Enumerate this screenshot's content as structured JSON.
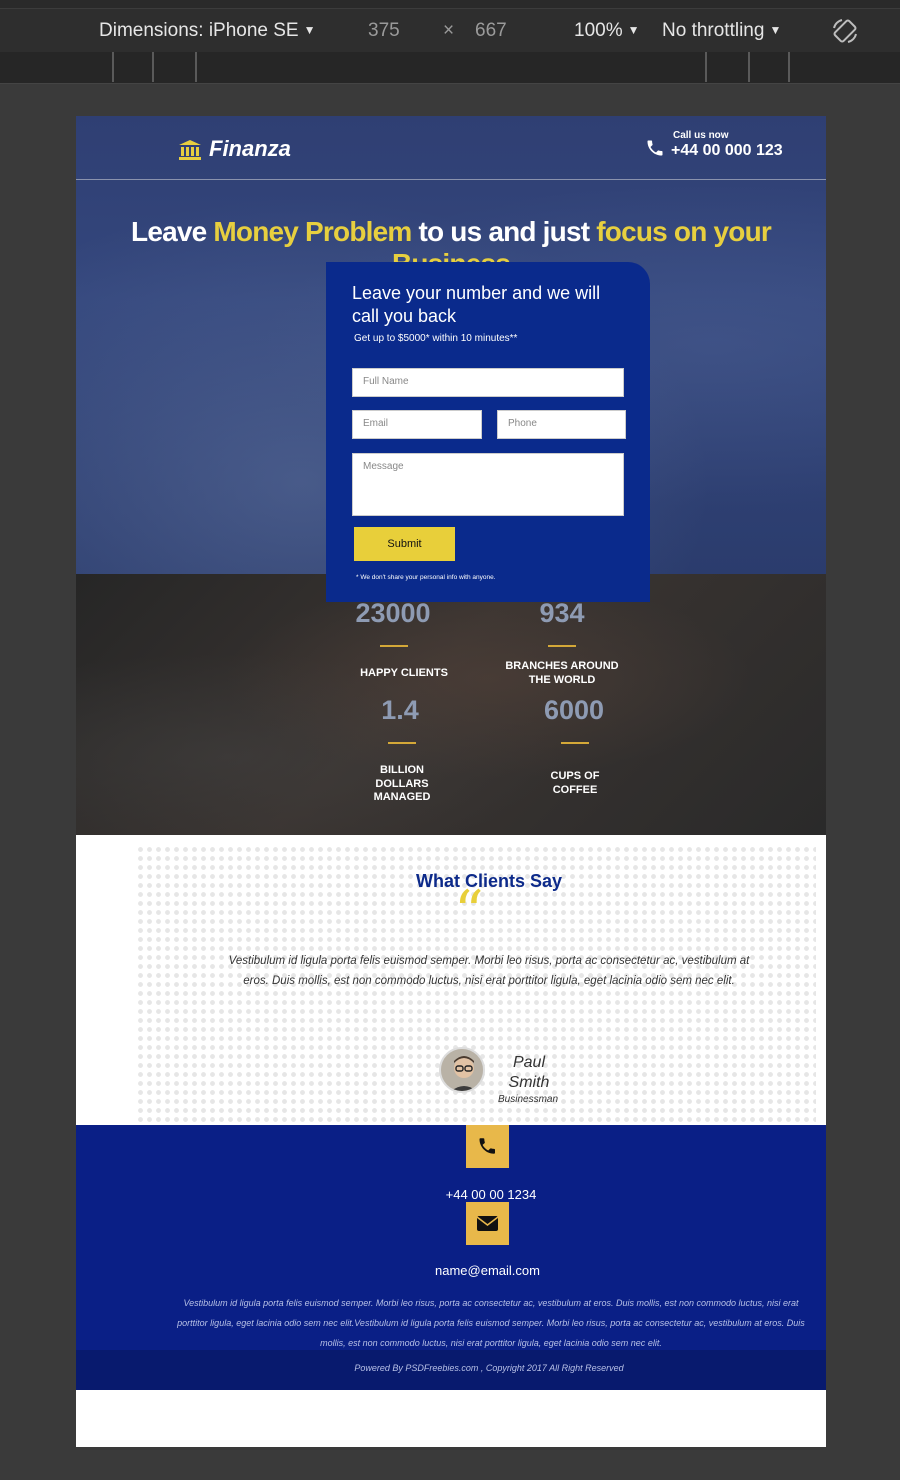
{
  "devtools": {
    "dimensions_label": "Dimensions: iPhone SE",
    "width": "375",
    "times": "×",
    "height": "667",
    "zoom": "100%",
    "throttling": "No throttling",
    "rotate_icon": "rotate-icon"
  },
  "header": {
    "brand": "Finanza",
    "call_label": "Call us now",
    "call_number": "+44 00 000 123"
  },
  "hero": {
    "headline_1": "Leave ",
    "headline_2": "Money Problem",
    "headline_3": " to us and just ",
    "headline_4": "focus on your Business"
  },
  "form": {
    "title": "Leave your number and we will call you back",
    "subtitle": "Get up to $5000* within 10 minutes**",
    "fullname_placeholder": "Full Name",
    "email_placeholder": "Email",
    "phone_placeholder": "Phone",
    "message_placeholder": "Message",
    "submit_label": "Submit",
    "note": "* We don't share your personal info with anyone."
  },
  "stats": [
    {
      "value": "23000",
      "label": "HAPPY CLIENTS"
    },
    {
      "value": "934",
      "label": "BRANCHES AROUND THE WORLD"
    },
    {
      "value": "1.4",
      "label": "BILLION DOLLARS MANAGED"
    },
    {
      "value": "6000",
      "label": "CUPS OF COFFEE"
    }
  ],
  "testimonials": {
    "title": "What Clients Say",
    "quote": "Vestibulum id ligula porta felis euismod semper. Morbi leo risus, porta ac consectetur ac, vestibulum at eros. Duis mollis, est non commodo luctus, nisi erat porttitor ligula, eget lacinia odio sem nec elit.",
    "name": "Paul Smith",
    "role": "Businessman"
  },
  "contact": {
    "phone": "+44 00 00 1234",
    "email": "name@email.com",
    "text": "Vestibulum id ligula porta felis euismod semper. Morbi leo risus, porta ac consectetur ac, vestibulum at eros. Duis mollis, est non commodo luctus, nisi erat porttitor ligula, eget lacinia odio sem nec elit.Vestibulum id ligula porta felis euismod semper. Morbi leo risus, porta ac consectetur ac, vestibulum at eros. Duis mollis, est non commodo luctus, nisi erat porttitor ligula, eget lacinia odio sem nec elit."
  },
  "footer": {
    "text": "Powered By PSDFreebies.com , Copyright 2017 All Right Reserved"
  },
  "colors": {
    "accent_yellow": "#e7cf3f",
    "form_blue": "#0a2a8c",
    "contact_blue": "#0a1f86",
    "icon_gold": "#e8b84a"
  }
}
